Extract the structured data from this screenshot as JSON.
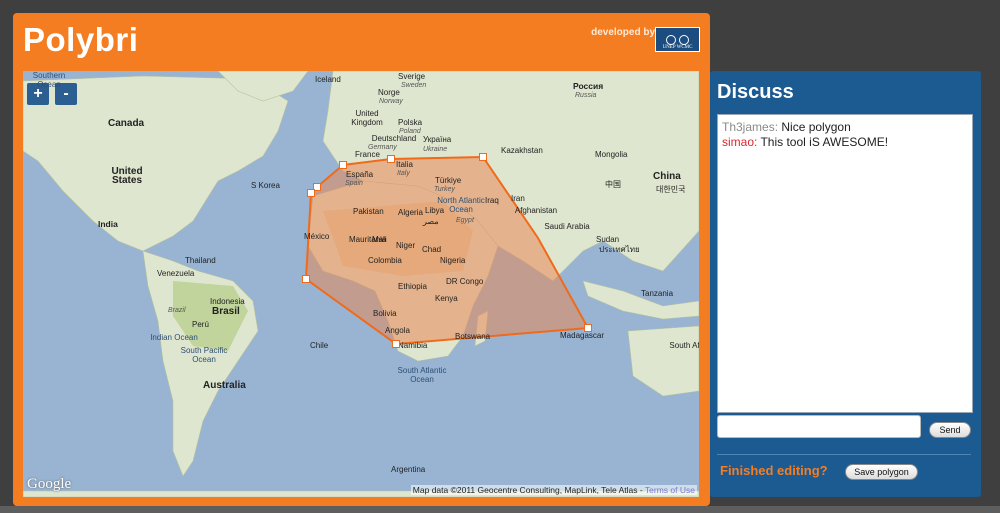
{
  "app": {
    "title": "Polybri",
    "developed_by": "developed by",
    "logo_text": "UNEP WCMC"
  },
  "map": {
    "zoom_in": "+",
    "zoom_out": "-",
    "google": "Google",
    "attribution": "Map data ©2011 Geocentre Consulting, MapLink, Tele Atlas - ",
    "terms": "Terms of Use",
    "labels": [
      {
        "text": "Iceland",
        "style": ""
      },
      {
        "text": "Sverige",
        "style": ""
      },
      {
        "text": "Sweden",
        "style": "i"
      },
      {
        "text": "Norge",
        "style": ""
      },
      {
        "text": "Norway",
        "style": "i"
      },
      {
        "text": "Россия",
        "style": "b"
      },
      {
        "text": "Russia",
        "style": "i"
      },
      {
        "text": "Canada",
        "style": "lg"
      },
      {
        "text": "United Kingdom",
        "style": ""
      },
      {
        "text": "Polska",
        "style": ""
      },
      {
        "text": "Poland",
        "style": "i"
      },
      {
        "text": "Deutschland",
        "style": ""
      },
      {
        "text": "Germany",
        "style": "i"
      },
      {
        "text": "Україна",
        "style": ""
      },
      {
        "text": "Ukraine",
        "style": "i"
      },
      {
        "text": "France",
        "style": ""
      },
      {
        "text": "Italia",
        "style": ""
      },
      {
        "text": "Italy",
        "style": "i"
      },
      {
        "text": "Kazakhstan",
        "style": ""
      },
      {
        "text": "Mongolia",
        "style": ""
      },
      {
        "text": "United States",
        "style": "lg"
      },
      {
        "text": "España",
        "style": ""
      },
      {
        "text": "Spain",
        "style": "i"
      },
      {
        "text": "Türkiye",
        "style": ""
      },
      {
        "text": "Turkey",
        "style": "i"
      },
      {
        "text": "中国",
        "style": ""
      },
      {
        "text": "China",
        "style": "lg"
      },
      {
        "text": "대한민국",
        "style": ""
      },
      {
        "text": "S Korea",
        "style": ""
      },
      {
        "text": "North Atlantic Ocean",
        "style": "ocean"
      },
      {
        "text": "Iraq",
        "style": ""
      },
      {
        "text": "Iran",
        "style": ""
      },
      {
        "text": "Afghanistan",
        "style": ""
      },
      {
        "text": "Pakistan",
        "style": ""
      },
      {
        "text": "Algeria",
        "style": ""
      },
      {
        "text": "Libya",
        "style": ""
      },
      {
        "text": "مصر",
        "style": ""
      },
      {
        "text": "Egypt",
        "style": "i"
      },
      {
        "text": "Saudi Arabia",
        "style": ""
      },
      {
        "text": "India",
        "style": "b"
      },
      {
        "text": "México",
        "style": ""
      },
      {
        "text": "Mauritania",
        "style": ""
      },
      {
        "text": "Mali",
        "style": ""
      },
      {
        "text": "Niger",
        "style": ""
      },
      {
        "text": "Chad",
        "style": ""
      },
      {
        "text": "Sudan",
        "style": ""
      },
      {
        "text": "ประเทศไทย",
        "style": ""
      },
      {
        "text": "Thailand",
        "style": ""
      },
      {
        "text": "Venezuela",
        "style": ""
      },
      {
        "text": "Colombia",
        "style": ""
      },
      {
        "text": "Nigeria",
        "style": ""
      },
      {
        "text": "Ethiopia",
        "style": ""
      },
      {
        "text": "DR Congo",
        "style": ""
      },
      {
        "text": "Kenya",
        "style": ""
      },
      {
        "text": "Tanzania",
        "style": ""
      },
      {
        "text": "Indonesia",
        "style": ""
      },
      {
        "text": "Brasil",
        "style": "lg"
      },
      {
        "text": "Brazil",
        "style": "i"
      },
      {
        "text": "Perú",
        "style": ""
      },
      {
        "text": "Bolivia",
        "style": ""
      },
      {
        "text": "Angola",
        "style": ""
      },
      {
        "text": "Namibia",
        "style": ""
      },
      {
        "text": "Botswana",
        "style": ""
      },
      {
        "text": "Madagascar",
        "style": ""
      },
      {
        "text": "Indian Ocean",
        "style": "ocean"
      },
      {
        "text": "South Pacific Ocean",
        "style": "ocean"
      },
      {
        "text": "Chile",
        "style": ""
      },
      {
        "text": "South Atlantic Ocean",
        "style": "ocean"
      },
      {
        "text": "South Africa",
        "style": ""
      },
      {
        "text": "Australia",
        "style": "lg"
      },
      {
        "text": "Argentina",
        "style": ""
      },
      {
        "text": "Southern Ocean",
        "style": "ocean"
      }
    ]
  },
  "discuss": {
    "title": "Discuss",
    "messages": [
      {
        "author": "Th3james:",
        "author_color": "gray",
        "text": " Nice polygon"
      },
      {
        "author": "simao:",
        "author_color": "red",
        "text": " This tool iS AWESOME!"
      }
    ],
    "input_value": "",
    "send_label": "Send",
    "finished_label": "Finished editing?",
    "save_label": "Save polygon"
  },
  "colors": {
    "accent_orange": "#f57d21",
    "panel_blue": "#1c5a92",
    "ocean": "#98b4d2",
    "polygon_fill": "#e8895a",
    "polygon_stroke": "#f06a1a"
  }
}
